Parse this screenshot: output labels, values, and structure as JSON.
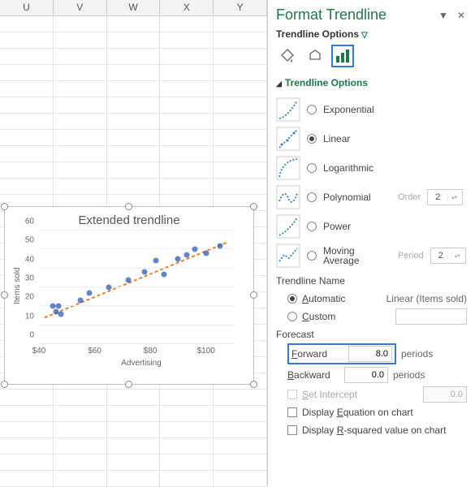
{
  "columns": [
    "U",
    "V",
    "W",
    "X",
    "Y"
  ],
  "panel": {
    "title": "Format Trendline",
    "subheader": "Trendline Options",
    "section": "Trendline Options",
    "types": {
      "exponential": "Exponential",
      "linear": "Linear",
      "logarithmic": "Logarithmic",
      "polynomial": "Polynomial",
      "power": "Power",
      "moving": "Moving Average",
      "order_label": "Order",
      "order_value": "2",
      "period_label": "Period",
      "period_value": "2"
    },
    "name_section": "Trendline Name",
    "automatic": "Automatic",
    "custom": "Custom",
    "auto_value": "Linear (Items sold)",
    "forecast_section": "Forecast",
    "forward": "Forward",
    "forward_value": "8.0",
    "backward": "Backward",
    "backward_value": "0.0",
    "periods": "periods",
    "set_intercept": "Set Intercept",
    "intercept_value": "0.0",
    "disp_eq": "Display Equation on chart",
    "disp_r2": "Display R-squared value on chart"
  },
  "chart_data": {
    "type": "scatter",
    "title": "Extended trendline",
    "xlabel": "Advertising",
    "ylabel": "Items sold",
    "xlim": [
      40,
      110
    ],
    "ylim": [
      0,
      60
    ],
    "xticks": [
      "$40",
      "$60",
      "$80",
      "$100"
    ],
    "yticks": [
      0,
      10,
      20,
      30,
      40,
      50,
      60
    ],
    "points": [
      {
        "x": 45,
        "y": 20
      },
      {
        "x": 46,
        "y": 17
      },
      {
        "x": 47,
        "y": 20
      },
      {
        "x": 48,
        "y": 16
      },
      {
        "x": 55,
        "y": 23
      },
      {
        "x": 58,
        "y": 27
      },
      {
        "x": 65,
        "y": 30
      },
      {
        "x": 72,
        "y": 34
      },
      {
        "x": 78,
        "y": 38
      },
      {
        "x": 82,
        "y": 44
      },
      {
        "x": 85,
        "y": 37
      },
      {
        "x": 90,
        "y": 45
      },
      {
        "x": 93,
        "y": 47
      },
      {
        "x": 96,
        "y": 50
      },
      {
        "x": 100,
        "y": 48
      },
      {
        "x": 105,
        "y": 52
      }
    ],
    "trend_from": {
      "x": 42,
      "y": 14
    },
    "trend_to": {
      "x": 108,
      "y": 54
    }
  }
}
